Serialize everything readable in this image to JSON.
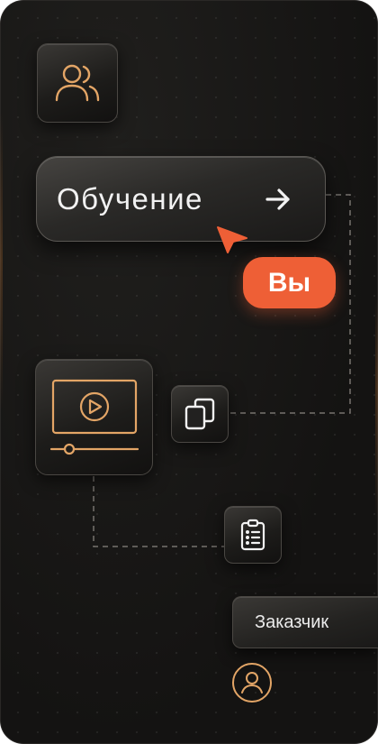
{
  "main": {
    "learn_button": {
      "label": "Обучение"
    },
    "you_badge": {
      "label": "Вы"
    },
    "customer_tag": {
      "label": "Заказчик"
    }
  },
  "icons": {
    "users": "users-icon",
    "arrow": "arrow-right-icon",
    "cursor": "cursor-pointer-icon",
    "video": "video-player-icon",
    "copy": "copy-documents-icon",
    "clipboard": "clipboard-list-icon",
    "avatar": "user-avatar-icon"
  },
  "colors": {
    "background": "#161514",
    "accent": "#ee5f36",
    "icon_gold": "#e3a566",
    "text": "#f2f2f2"
  }
}
